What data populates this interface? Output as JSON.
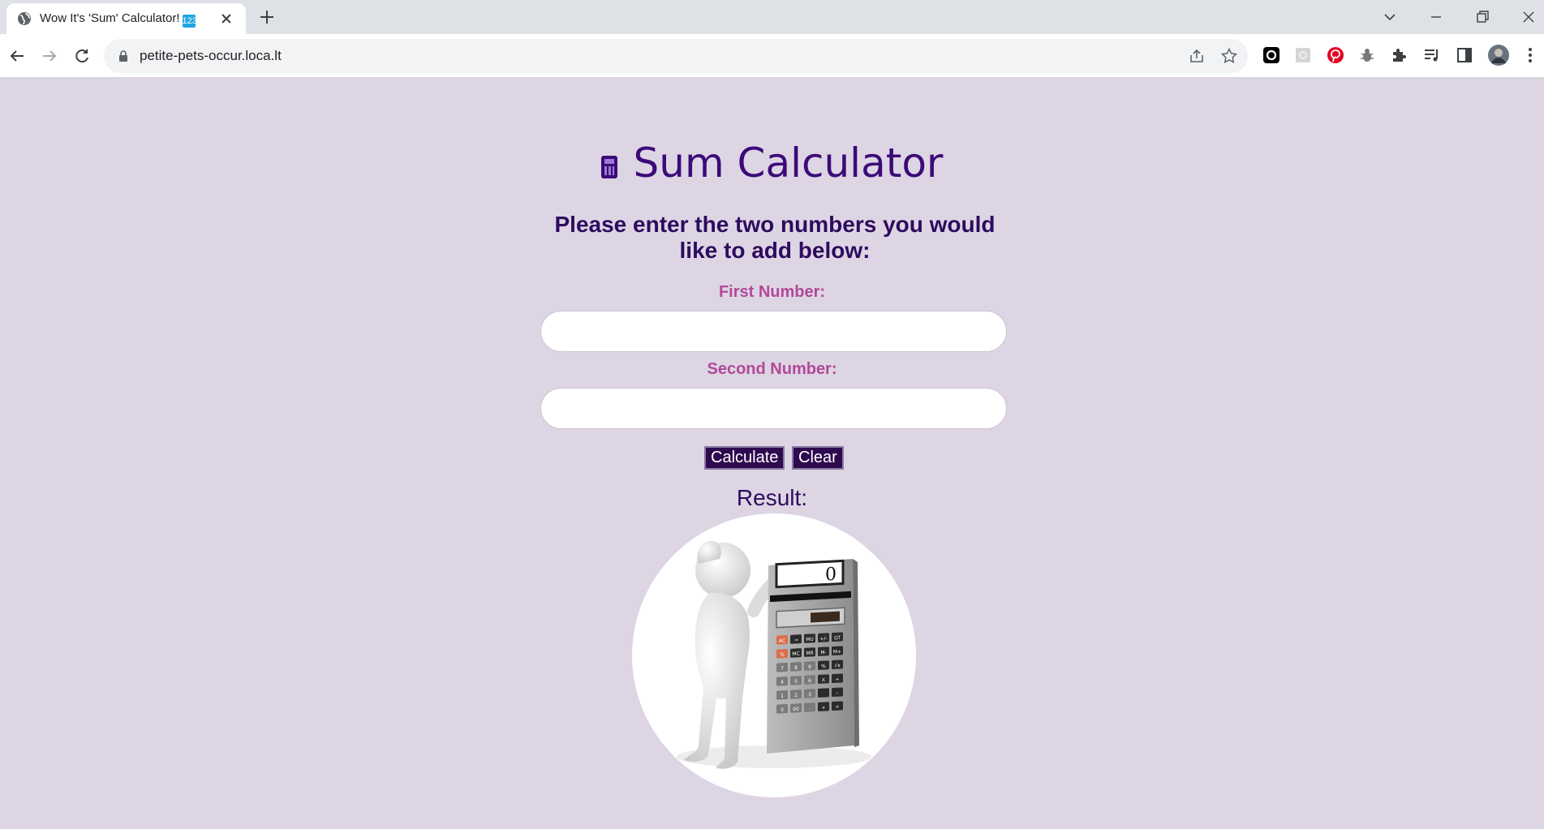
{
  "browser": {
    "tab_title": "Wow It's 'Sum' Calculator!",
    "tab_badge": "🔢",
    "url": "petite-pets-occur.loca.lt"
  },
  "page": {
    "title": "Sum Calculator",
    "title_icon": "abacus-icon",
    "subheading": "Please enter the two numbers you would like to add below:",
    "first_label": "First Number:",
    "first_value": "",
    "second_label": "Second Number:",
    "second_value": "",
    "calculate_label": "Calculate",
    "clear_label": "Clear",
    "result_label": "Result:",
    "calculator_display": "0",
    "calculator_keys": [
      [
        "AC",
        "→",
        "MU",
        "+/-",
        "GT"
      ],
      [
        "%",
        "MC",
        "MR",
        "M-",
        "M+"
      ],
      [
        "7",
        "8",
        "9",
        "%",
        "√x"
      ],
      [
        "4",
        "5",
        "6",
        "X",
        "÷"
      ],
      [
        "1",
        "2",
        "3",
        "",
        "-"
      ],
      [
        "0",
        "00",
        ".",
        "+",
        "="
      ]
    ]
  },
  "colors": {
    "page_bg": "#ddd5e4",
    "title": "#3b0a78",
    "label": "#b24898",
    "button_bg": "#2e0a4f"
  }
}
